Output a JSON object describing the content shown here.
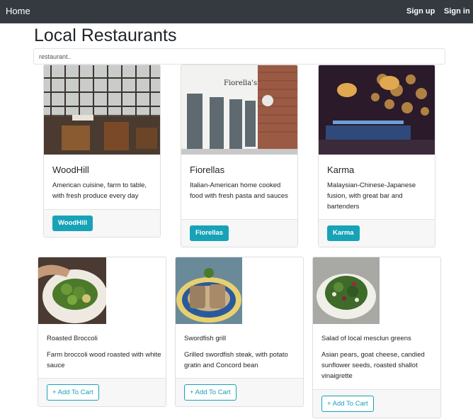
{
  "nav": {
    "home": "Home",
    "signup": "Sign up",
    "signin": "Sign in"
  },
  "page": {
    "title": "Local Restaurants"
  },
  "search": {
    "placeholder": "restaurant.."
  },
  "restaurants": [
    {
      "name": "WoodHill",
      "description": "American cuisine, farm to table, with fresh produce every day",
      "button": "WoodHill"
    },
    {
      "name": "Fiorellas",
      "description": "Italian-American home cooked food with fresh pasta and sauces",
      "button": "Fiorellas"
    },
    {
      "name": "Karma",
      "description": "Malaysian-Chinese-Japanese fusion, with great bar and bartenders",
      "button": "Karma"
    }
  ],
  "dishes": [
    {
      "name": "Roasted Broccoli",
      "description": "Farm broccoli wood roasted with white sauce",
      "button": "+ Add To Cart"
    },
    {
      "name": "Swordfish grill",
      "description": "Grilled swordfish steak, with potato gratin and Concord bean",
      "button": "+ Add To Cart"
    },
    {
      "name": "Salad of local mesclun greens",
      "description": "Asian pears, goat cheese, candied sunflower seeds, roasted shallot vinaigrette",
      "button": "+ Add To Cart"
    }
  ],
  "colors": {
    "navbar": "#343a40",
    "accent": "#17a2b8"
  }
}
